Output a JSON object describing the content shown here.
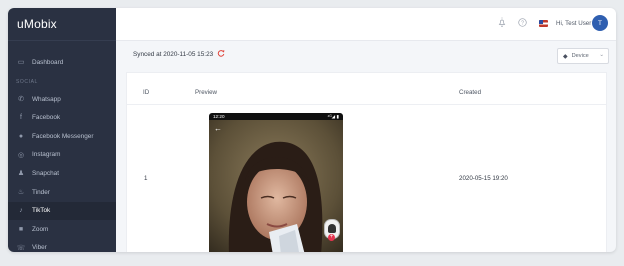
{
  "app": {
    "brand": "uMobix"
  },
  "sidebar": {
    "dashboard": {
      "label": "Dashboard",
      "icon": "dashboard-icon"
    },
    "section_label": "SOCIAL",
    "items": [
      {
        "label": "Whatsapp",
        "icon": "whatsapp-icon",
        "glyph": "✆"
      },
      {
        "label": "Facebook",
        "icon": "facebook-icon",
        "glyph": "f"
      },
      {
        "label": "Facebook Messenger",
        "icon": "messenger-icon",
        "glyph": "●"
      },
      {
        "label": "Instagram",
        "icon": "instagram-icon",
        "glyph": "◎"
      },
      {
        "label": "Snapchat",
        "icon": "snapchat-icon",
        "glyph": "♟"
      },
      {
        "label": "Tinder",
        "icon": "tinder-icon",
        "glyph": "♨"
      },
      {
        "label": "TikTok",
        "icon": "tiktok-icon",
        "glyph": "♪"
      },
      {
        "label": "Zoom",
        "icon": "zoom-icon",
        "glyph": "■"
      },
      {
        "label": "Viber",
        "icon": "viber-icon",
        "glyph": "☏"
      }
    ],
    "active_item": "TikTok",
    "colors": {
      "background": "#2a3142",
      "active": "#232937"
    }
  },
  "topbar": {
    "greeting": "Hi, Test User",
    "avatar_initial": "T",
    "icons": [
      "bell-icon",
      "help-icon",
      "flag-icon"
    ]
  },
  "sync": {
    "text": "Synced at 2020-11-05 15:23",
    "refresh_icon": "refresh-icon",
    "refresh_color": "#e0453c"
  },
  "device_select": {
    "selected": "Device"
  },
  "table": {
    "columns": [
      "ID",
      "Preview",
      "Created"
    ],
    "rows": [
      {
        "id": "1",
        "created": "2020-05-15 19:20",
        "preview": {
          "status_time": "12:20",
          "status_right": "⁴ᴳ◢ ▮"
        }
      }
    ]
  }
}
